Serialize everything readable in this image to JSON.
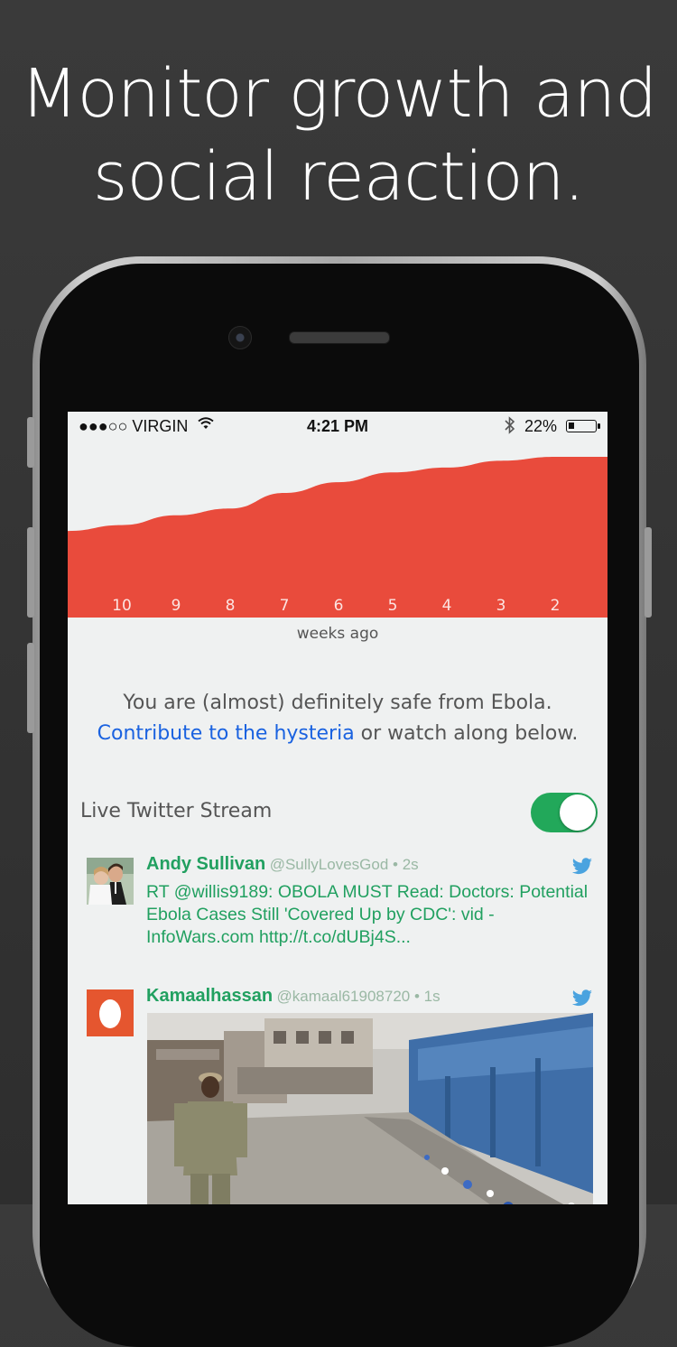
{
  "headline": {
    "line1": "Monitor growth and",
    "line2": "social reaction."
  },
  "status_bar": {
    "carrier": "●●●○○ VIRGIN",
    "time": "4:21 PM",
    "battery": "22%",
    "battery_level": 0.22
  },
  "chart_data": {
    "type": "area",
    "x": [
      10,
      9,
      8,
      7,
      6,
      5,
      4,
      3,
      2
    ],
    "xlabel": "weeks ago",
    "tick_labels": [
      "10",
      "9",
      "8",
      "7",
      "6",
      "5",
      "4",
      "3",
      "2"
    ],
    "values": [
      0.3,
      0.4,
      0.47,
      0.63,
      0.74,
      0.84,
      0.89,
      0.96,
      1.0
    ],
    "color": "#e94b3c",
    "grid": false
  },
  "message": {
    "line1": "You are (almost) definitely safe from Ebola.",
    "link": "Contribute to the hysteria",
    "line2_rest": " or watch along below."
  },
  "stream": {
    "label": "Live Twitter Stream",
    "enabled": true,
    "accent": "#22a85a"
  },
  "tweets": [
    {
      "name": "Andy Sullivan",
      "meta": "@SullyLovesGod • 2s",
      "text": "RT @willis9189: OBOLA MUST Read: Doctors: Potential Ebola Cases Still 'Covered Up by CDC': vid - InfoWars.com  http://t.co/dUBj4S..."
    },
    {
      "name": "Kamaalhassan",
      "meta": "@kamaal61908720 • 1s"
    }
  ]
}
